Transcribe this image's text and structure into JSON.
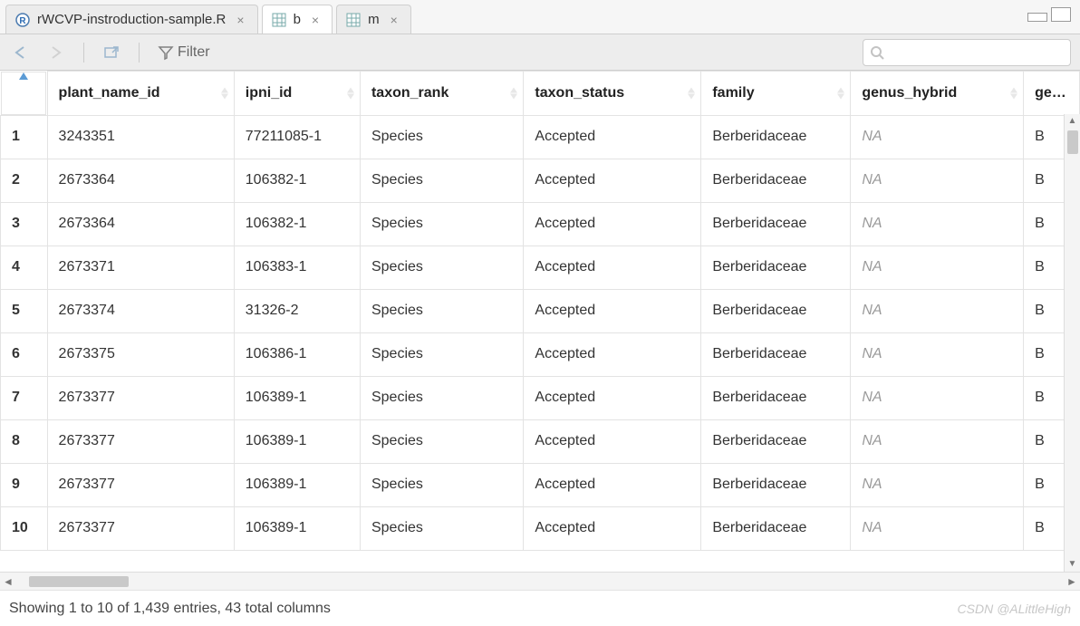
{
  "tabs": [
    {
      "label": "rWCVP-instroduction-sample.R",
      "icon": "r-file",
      "active": false
    },
    {
      "label": "b",
      "icon": "grid",
      "active": true
    },
    {
      "label": "m",
      "icon": "grid",
      "active": false
    }
  ],
  "toolbar": {
    "filter_label": "Filter",
    "search_placeholder": ""
  },
  "columns": [
    "plant_name_id",
    "ipni_id",
    "taxon_rank",
    "taxon_status",
    "family",
    "genus_hybrid",
    "genu"
  ],
  "rows": [
    {
      "n": "1",
      "plant_name_id": "3243351",
      "ipni_id": "77211085-1",
      "taxon_rank": "Species",
      "taxon_status": "Accepted",
      "family": "Berberidaceae",
      "genus_hybrid": "NA",
      "genus": "B"
    },
    {
      "n": "2",
      "plant_name_id": "2673364",
      "ipni_id": "106382-1",
      "taxon_rank": "Species",
      "taxon_status": "Accepted",
      "family": "Berberidaceae",
      "genus_hybrid": "NA",
      "genus": "B"
    },
    {
      "n": "3",
      "plant_name_id": "2673364",
      "ipni_id": "106382-1",
      "taxon_rank": "Species",
      "taxon_status": "Accepted",
      "family": "Berberidaceae",
      "genus_hybrid": "NA",
      "genus": "B"
    },
    {
      "n": "4",
      "plant_name_id": "2673371",
      "ipni_id": "106383-1",
      "taxon_rank": "Species",
      "taxon_status": "Accepted",
      "family": "Berberidaceae",
      "genus_hybrid": "NA",
      "genus": "B"
    },
    {
      "n": "5",
      "plant_name_id": "2673374",
      "ipni_id": "31326-2",
      "taxon_rank": "Species",
      "taxon_status": "Accepted",
      "family": "Berberidaceae",
      "genus_hybrid": "NA",
      "genus": "B"
    },
    {
      "n": "6",
      "plant_name_id": "2673375",
      "ipni_id": "106386-1",
      "taxon_rank": "Species",
      "taxon_status": "Accepted",
      "family": "Berberidaceae",
      "genus_hybrid": "NA",
      "genus": "B"
    },
    {
      "n": "7",
      "plant_name_id": "2673377",
      "ipni_id": "106389-1",
      "taxon_rank": "Species",
      "taxon_status": "Accepted",
      "family": "Berberidaceae",
      "genus_hybrid": "NA",
      "genus": "B"
    },
    {
      "n": "8",
      "plant_name_id": "2673377",
      "ipni_id": "106389-1",
      "taxon_rank": "Species",
      "taxon_status": "Accepted",
      "family": "Berberidaceae",
      "genus_hybrid": "NA",
      "genus": "B"
    },
    {
      "n": "9",
      "plant_name_id": "2673377",
      "ipni_id": "106389-1",
      "taxon_rank": "Species",
      "taxon_status": "Accepted",
      "family": "Berberidaceae",
      "genus_hybrid": "NA",
      "genus": "B"
    },
    {
      "n": "10",
      "plant_name_id": "2673377",
      "ipni_id": "106389-1",
      "taxon_rank": "Species",
      "taxon_status": "Accepted",
      "family": "Berberidaceae",
      "genus_hybrid": "NA",
      "genus": "B"
    }
  ],
  "status": {
    "summary": "Showing 1 to 10 of 1,439 entries, 43 total columns",
    "watermark": "CSDN @ALittleHigh"
  }
}
